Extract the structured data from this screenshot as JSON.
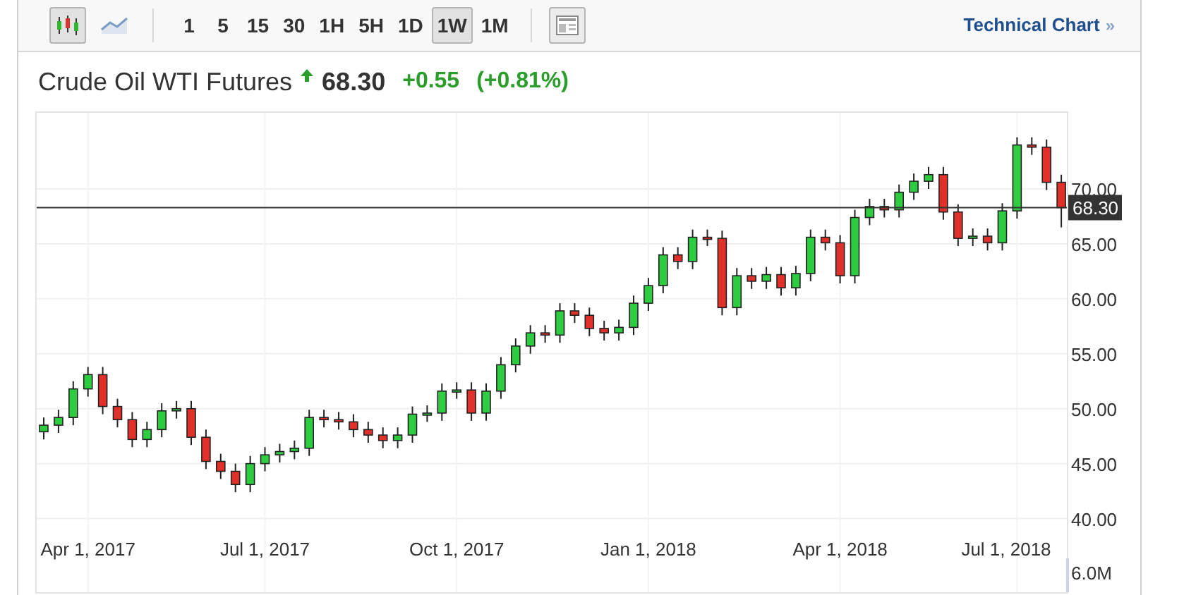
{
  "toolbar": {
    "chart_types": [
      {
        "kind": "candles",
        "selected": true
      },
      {
        "kind": "line",
        "selected": false
      }
    ],
    "intervals": [
      {
        "label": "1",
        "selected": false
      },
      {
        "label": "5",
        "selected": false
      },
      {
        "label": "15",
        "selected": false
      },
      {
        "label": "30",
        "selected": false
      },
      {
        "label": "1H",
        "selected": false
      },
      {
        "label": "5H",
        "selected": false
      },
      {
        "label": "1D",
        "selected": false
      },
      {
        "label": "1W",
        "selected": true
      },
      {
        "label": "1M",
        "selected": false
      }
    ],
    "link": {
      "label": "Technical Chart",
      "arrow": "»"
    }
  },
  "quote": {
    "name": "Crude Oil WTI Futures",
    "up": true,
    "price": "68.30",
    "change": "+0.55",
    "change_percent": "(+0.81%)"
  },
  "chart": {
    "price_tag": "68.30",
    "volume_label": "6.0M",
    "chart_data": {
      "type": "candlestick",
      "ylim": [
        33.3,
        76.8
      ],
      "grid": true,
      "ref_lines": [
        {
          "axis": "y",
          "value": 68.3,
          "color": "#333333"
        }
      ],
      "yticks": [
        {
          "value": 40,
          "label": "40.00"
        },
        {
          "value": 45,
          "label": "45.00"
        },
        {
          "value": 50,
          "label": "50.00"
        },
        {
          "value": 55,
          "label": "55.00"
        },
        {
          "value": 60,
          "label": "60.00"
        },
        {
          "value": 65,
          "label": "65.00"
        },
        {
          "value": 70,
          "label": "70.00"
        }
      ],
      "categories": [
        null,
        null,
        null,
        "Apr 1, 2017",
        null,
        null,
        null,
        null,
        null,
        null,
        null,
        null,
        null,
        null,
        null,
        "Jul 1, 2017",
        null,
        null,
        null,
        null,
        null,
        null,
        null,
        null,
        null,
        null,
        null,
        null,
        "Oct 1, 2017",
        null,
        null,
        null,
        null,
        null,
        null,
        null,
        null,
        null,
        null,
        null,
        null,
        "Jan 1, 2018",
        null,
        null,
        null,
        null,
        null,
        null,
        null,
        null,
        null,
        null,
        null,
        null,
        "Apr 1, 2018",
        null,
        null,
        null,
        null,
        null,
        null,
        null,
        null,
        null,
        null,
        null,
        "Jul 1, 2018",
        null,
        null,
        null
      ],
      "ohlc": [
        [
          47.9,
          49.2,
          47.2,
          48.5
        ],
        [
          48.5,
          49.9,
          47.8,
          49.2
        ],
        [
          49.2,
          52.5,
          48.5,
          51.8
        ],
        [
          51.8,
          53.8,
          51.1,
          53.1
        ],
        [
          53.1,
          53.8,
          49.5,
          50.2
        ],
        [
          50.2,
          50.9,
          48.3,
          49.0
        ],
        [
          49.0,
          49.7,
          46.5,
          47.2
        ],
        [
          47.2,
          48.8,
          46.5,
          48.1
        ],
        [
          48.1,
          50.5,
          47.4,
          49.8
        ],
        [
          49.8,
          50.7,
          49.1,
          50.0
        ],
        [
          50.0,
          50.7,
          46.7,
          47.4
        ],
        [
          47.4,
          48.1,
          44.5,
          45.2
        ],
        [
          45.2,
          45.9,
          43.6,
          44.3
        ],
        [
          44.3,
          45.0,
          42.4,
          43.1
        ],
        [
          43.1,
          45.7,
          42.4,
          45.0
        ],
        [
          45.0,
          46.5,
          44.3,
          45.8
        ],
        [
          45.8,
          46.8,
          45.1,
          46.1
        ],
        [
          46.1,
          47.1,
          45.4,
          46.4
        ],
        [
          46.4,
          49.9,
          45.7,
          49.2
        ],
        [
          49.2,
          49.9,
          48.3,
          49.0
        ],
        [
          49.0,
          49.7,
          48.1,
          48.8
        ],
        [
          48.8,
          49.5,
          47.4,
          48.1
        ],
        [
          48.1,
          48.8,
          46.9,
          47.6
        ],
        [
          47.6,
          48.3,
          46.4,
          47.1
        ],
        [
          47.1,
          48.3,
          46.4,
          47.6
        ],
        [
          47.6,
          50.2,
          46.9,
          49.5
        ],
        [
          49.5,
          50.3,
          48.8,
          49.6
        ],
        [
          49.6,
          52.3,
          48.9,
          51.6
        ],
        [
          51.6,
          52.4,
          50.9,
          51.7
        ],
        [
          51.7,
          52.4,
          48.9,
          49.6
        ],
        [
          49.6,
          52.3,
          48.9,
          51.6
        ],
        [
          51.6,
          54.7,
          50.9,
          54.0
        ],
        [
          54.0,
          56.4,
          53.3,
          55.7
        ],
        [
          55.7,
          57.6,
          55.0,
          56.9
        ],
        [
          56.9,
          57.6,
          56.0,
          56.7
        ],
        [
          56.7,
          59.6,
          56.0,
          58.9
        ],
        [
          58.9,
          59.6,
          57.8,
          58.5
        ],
        [
          58.5,
          59.2,
          56.6,
          57.3
        ],
        [
          57.3,
          58.0,
          56.2,
          56.9
        ],
        [
          56.9,
          58.1,
          56.2,
          57.4
        ],
        [
          57.4,
          60.3,
          56.7,
          59.6
        ],
        [
          59.6,
          61.9,
          58.9,
          61.2
        ],
        [
          61.2,
          64.7,
          60.5,
          64.0
        ],
        [
          64.0,
          64.7,
          62.7,
          63.4
        ],
        [
          63.4,
          66.3,
          62.7,
          65.6
        ],
        [
          65.6,
          66.3,
          64.8,
          65.5
        ],
        [
          65.5,
          66.2,
          58.5,
          59.2
        ],
        [
          59.2,
          62.8,
          58.5,
          62.1
        ],
        [
          62.1,
          62.8,
          60.9,
          61.6
        ],
        [
          61.6,
          62.9,
          60.9,
          62.2
        ],
        [
          62.2,
          62.9,
          60.3,
          61.0
        ],
        [
          61.0,
          63.0,
          60.3,
          62.3
        ],
        [
          62.3,
          66.3,
          61.6,
          65.6
        ],
        [
          65.6,
          66.3,
          64.4,
          65.1
        ],
        [
          65.1,
          65.8,
          61.4,
          62.1
        ],
        [
          62.1,
          68.1,
          61.4,
          67.4
        ],
        [
          67.4,
          69.1,
          66.7,
          68.4
        ],
        [
          68.4,
          69.1,
          67.4,
          68.1
        ],
        [
          68.1,
          70.4,
          67.4,
          69.7
        ],
        [
          69.7,
          71.4,
          69.0,
          70.7
        ],
        [
          70.7,
          72.0,
          70.0,
          71.3
        ],
        [
          71.3,
          72.0,
          67.2,
          67.9
        ],
        [
          67.9,
          68.6,
          64.8,
          65.5
        ],
        [
          65.5,
          66.4,
          64.8,
          65.7
        ],
        [
          65.7,
          66.4,
          64.4,
          65.1
        ],
        [
          65.1,
          68.7,
          64.4,
          68.0
        ],
        [
          68.0,
          74.7,
          67.3,
          74.0
        ],
        [
          74.0,
          74.7,
          73.1,
          73.8
        ],
        [
          73.8,
          74.5,
          69.9,
          70.6
        ],
        [
          70.6,
          71.3,
          66.5,
          68.3
        ]
      ]
    }
  }
}
